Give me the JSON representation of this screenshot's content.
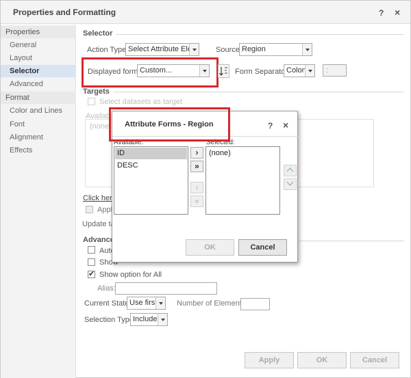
{
  "window": {
    "title": "Properties and Formatting",
    "help": "?",
    "close": "×"
  },
  "sidebar": {
    "properties_header": "Properties",
    "properties_items": [
      "General",
      "Layout",
      "Selector",
      "Advanced"
    ],
    "format_header": "Format",
    "format_items": [
      "Color and Lines",
      "Font",
      "Alignment",
      "Effects"
    ]
  },
  "selector": {
    "section_title": "Selector",
    "action_type_label": "Action Type:",
    "action_type_value": "Select Attribute Element",
    "source_label": "Source:",
    "source_value": "Region",
    "displayed_forms_label": "Displayed forms:",
    "displayed_forms_value": "Custom...",
    "form_separator_label": "Form Separator:",
    "form_separator_value": "Colon",
    "separator_preview": ":"
  },
  "targets": {
    "section_title": "Targets",
    "select_datasets": "Select datasets as target",
    "available_label": "Availab",
    "none_item": "(none)"
  },
  "middle": {
    "click_here": "Click here",
    "apply_label": "Apply",
    "update_label": "Update tar"
  },
  "advanced": {
    "section_title": "Advance",
    "auto_label": "Auto",
    "show_label": "Show",
    "show_all_label": "Show option for All",
    "alias_label": "Alias:",
    "current_state_label": "Current State:",
    "current_state_value": "Use first",
    "number_of_elements_label": "Number of Elements:",
    "selection_type_label": "Selection Type:",
    "selection_type_value": "Include"
  },
  "buttons": {
    "apply": "Apply",
    "ok": "OK",
    "cancel": "Cancel"
  },
  "dialog": {
    "title": "Attribute Forms - Region",
    "help": "?",
    "close": "×",
    "available_label": "Available:",
    "selected_label": "Selected:",
    "available_items": [
      "ID",
      "DESC"
    ],
    "selected_items": [
      "(none)"
    ],
    "ok": "OK",
    "cancel": "Cancel"
  },
  "colors": {
    "highlight_red": "#d7262c",
    "sidebar_selected": "#d8e4f2"
  }
}
